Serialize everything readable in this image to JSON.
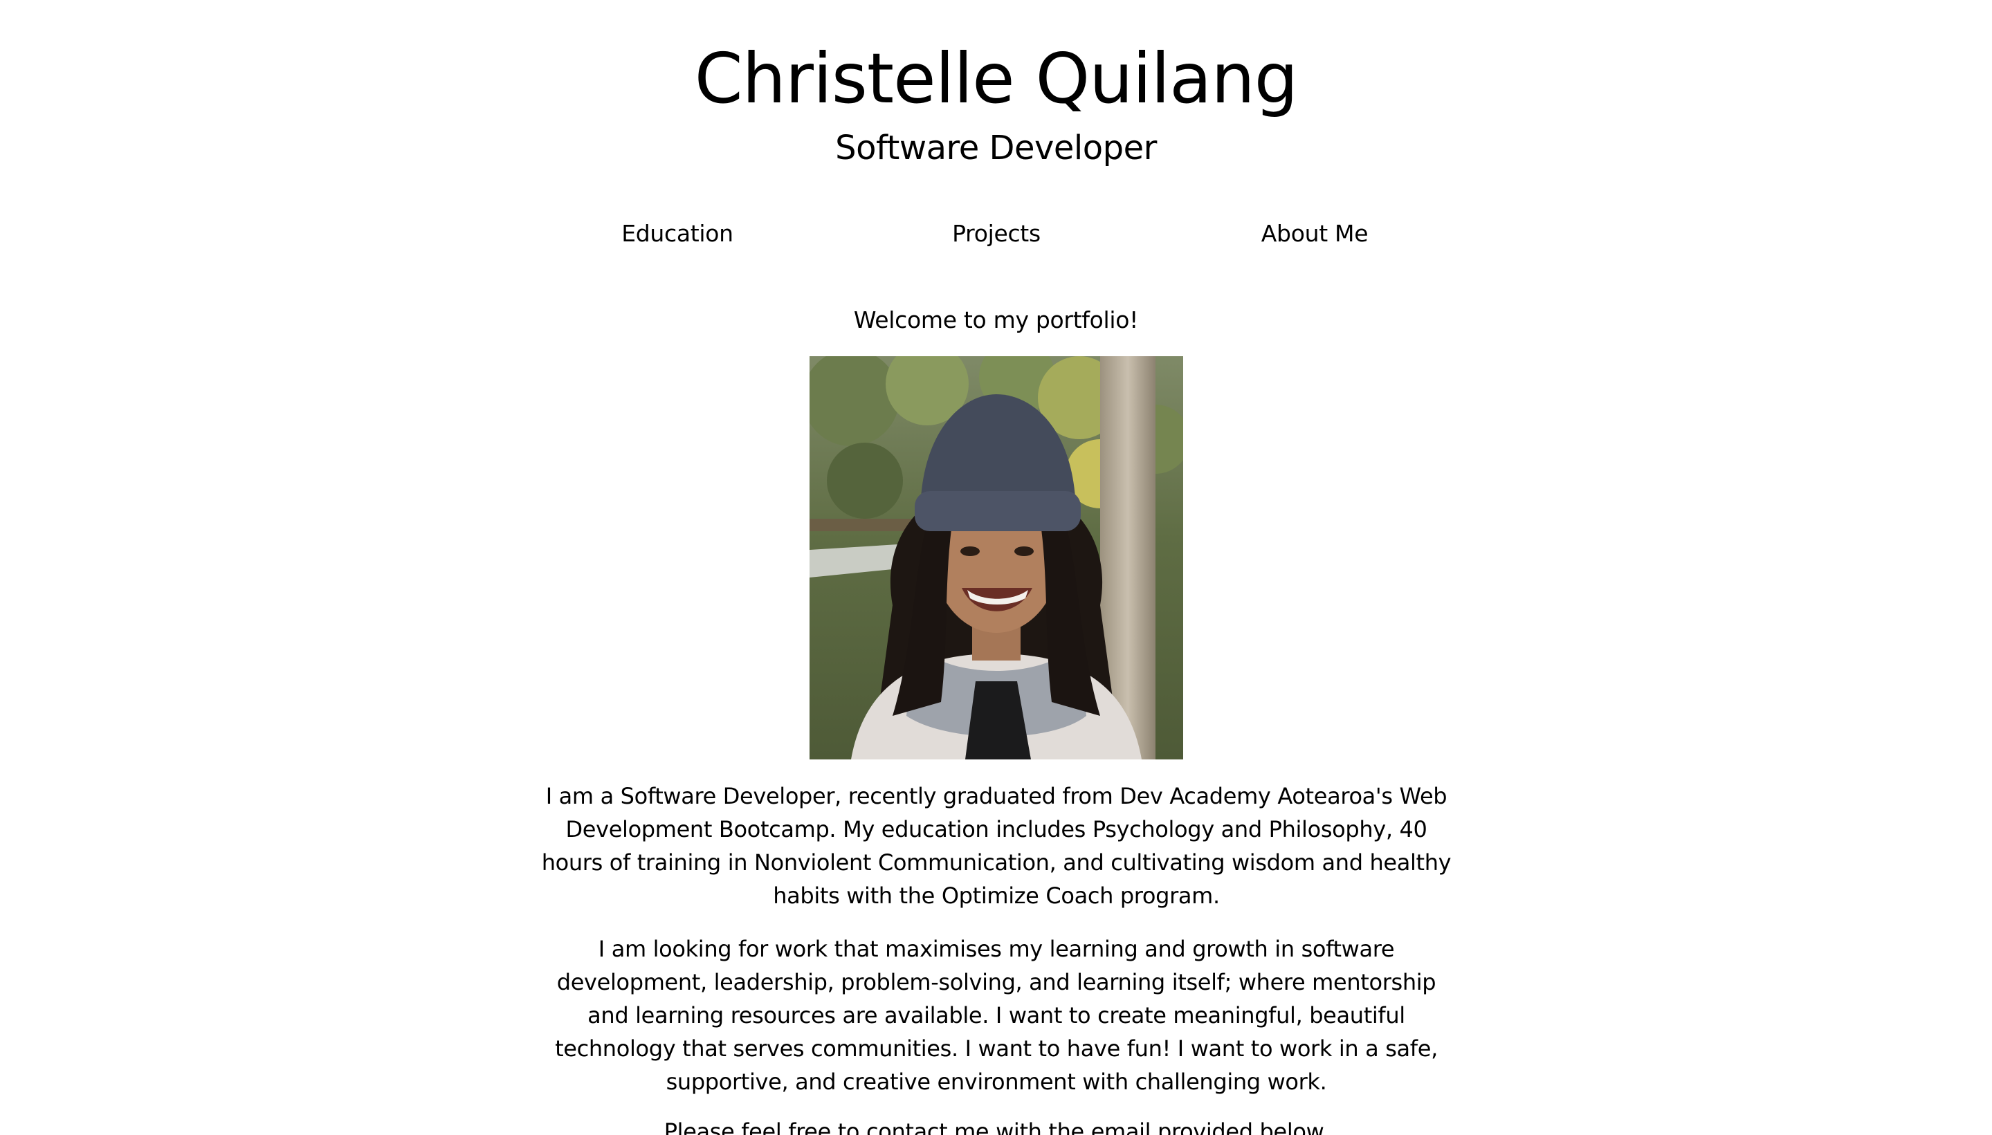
{
  "header": {
    "title": "Christelle Quilang",
    "subtitle": "Software Developer"
  },
  "nav": {
    "items": [
      {
        "label": "Education"
      },
      {
        "label": "Projects"
      },
      {
        "label": "About Me"
      }
    ]
  },
  "main": {
    "welcome": "Welcome to my portfolio!",
    "photo_alt": "Portrait photo of Christelle Quilang",
    "paragraphs": [
      "I am a Software Developer, recently graduated from Dev Academy Aotearoa's Web Development Bootcamp. My education includes Psychology and Philosophy, 40 hours of training in Nonviolent Communication, and cultivating wisdom and healthy habits with the Optimize Coach program.",
      "I am looking for work that maximises my learning and growth in software development, leadership, problem-solving, and learning itself; where mentorship and learning resources are available. I want to create meaningful, beautiful technology that serves communities. I want to have fun! I want to work in a safe, supportive, and creative environment with challenging work.",
      "Please feel free to contact me with the email provided below."
    ]
  },
  "colors": {
    "background": "#ffffff",
    "text": "#000000"
  }
}
